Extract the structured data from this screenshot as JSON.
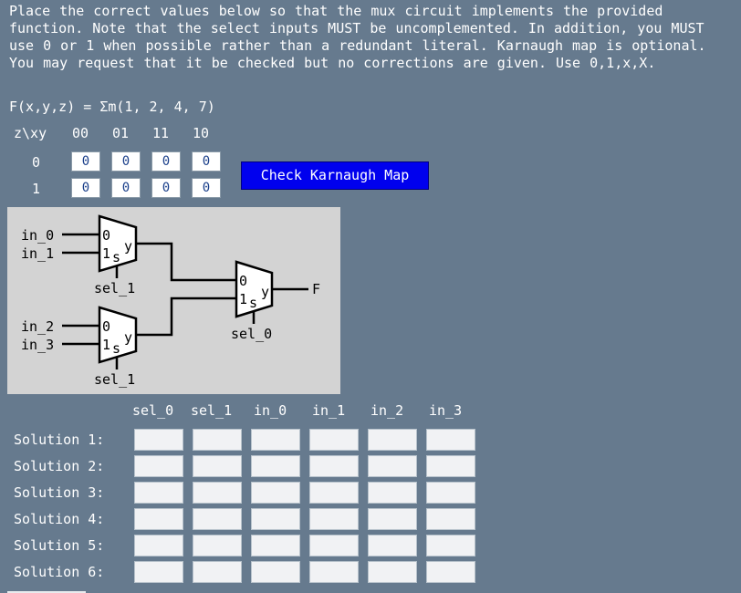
{
  "instructions": "Place the correct values below so that the mux circuit implements the provided function. Note that the select inputs MUST be uncomplemented. In addition, you MUST use 0 or 1 when possible rather than a redundant literal. Karnaugh map is optional. You may request that it be checked but no corrections are given. Use 0,1,x,X.",
  "function_text": "F(x,y,z) = Σm(1, 2, 4, 7)",
  "kmap": {
    "corner_label": "z\\xy",
    "col_headers": [
      "00",
      "01",
      "11",
      "10"
    ],
    "row_headers": [
      "0",
      "1"
    ],
    "cells": [
      [
        "0",
        "0",
        "0",
        "0"
      ],
      [
        "0",
        "0",
        "0",
        "0"
      ]
    ]
  },
  "check_button_label": "Check Karnaugh Map",
  "circuit": {
    "inputs": [
      "in_0",
      "in_1",
      "in_2",
      "in_3"
    ],
    "mux_data_labels": [
      "0",
      "1"
    ],
    "mux_select_symbol": "s",
    "mux_output_symbol": "y",
    "select_labels": [
      "sel_1",
      "sel_1",
      "sel_0"
    ],
    "output_label": "F"
  },
  "solution_table": {
    "columns": [
      "sel_0",
      "sel_1",
      "in_0",
      "in_1",
      "in_2",
      "in_3"
    ],
    "rows": [
      {
        "label": "Solution 1:",
        "values": [
          "",
          "",
          "",
          "",
          "",
          ""
        ]
      },
      {
        "label": "Solution 2:",
        "values": [
          "",
          "",
          "",
          "",
          "",
          ""
        ]
      },
      {
        "label": "Solution 3:",
        "values": [
          "",
          "",
          "",
          "",
          "",
          ""
        ]
      },
      {
        "label": "Solution 4:",
        "values": [
          "",
          "",
          "",
          "",
          "",
          ""
        ]
      },
      {
        "label": "Solution 5:",
        "values": [
          "",
          "",
          "",
          "",
          "",
          ""
        ]
      },
      {
        "label": "Solution 6:",
        "values": [
          "",
          "",
          "",
          "",
          "",
          ""
        ]
      }
    ]
  },
  "colors": {
    "background": "#667a8e",
    "button": "#0000ee",
    "circuit_panel": "#d3d3d3",
    "kmap_cell_text": "#1a3f8a"
  }
}
